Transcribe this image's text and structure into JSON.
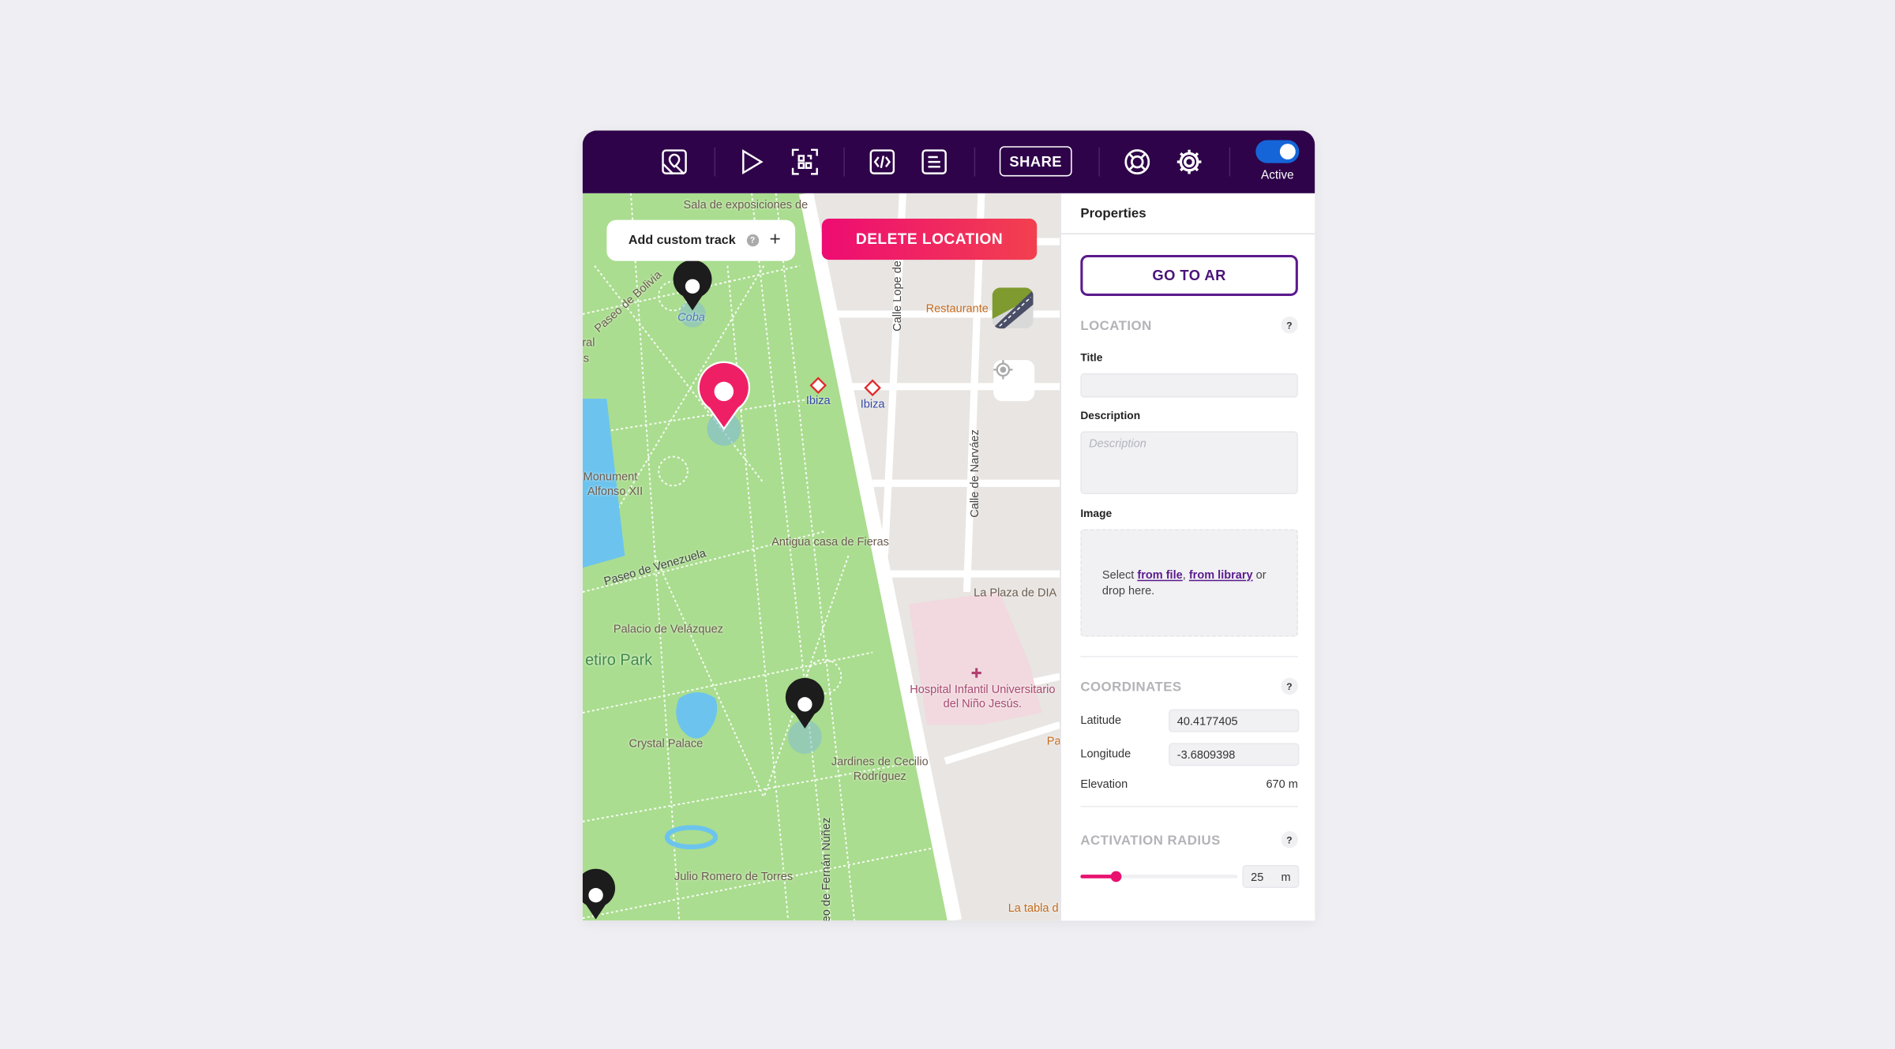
{
  "toolbar": {
    "icons": [
      "map-image-icon",
      "play-icon",
      "qr-scan-icon",
      "code-icon",
      "document-icon",
      "help-lifebuoy-icon",
      "gear-icon"
    ],
    "share_label": "SHARE",
    "toggle_label": "Active",
    "toggle_on": true,
    "background_color": "#2e0349"
  },
  "map": {
    "add_track_label": "Add custom track",
    "add_track_help": "?",
    "add_track_plus": "+",
    "delete_label": "DELETE LOCATION",
    "labels": {
      "sala": "Sala de exposiciones de",
      "bolivia": "Paseo de Bolivia",
      "coba": "Coba",
      "ibiza1": "Ibiza",
      "ibiza2": "Ibiza",
      "restaurante": "Restaurante",
      "lope": "Calle Lope de",
      "narvaez": "Calle de Narváez",
      "monument1": "Monument",
      "monument2": "Alfonso XII",
      "fieras": "Antigua casa de Fieras",
      "venezuela": "Paseo de Venezuela",
      "dia": "La Plaza de DIA",
      "velazquez": "Palacio de Velázquez",
      "retiro": "etiro Park",
      "hospital1": "Hospital Infantil Universitario",
      "hospital2": "del Niño Jesús.",
      "crystal": "Crystal Palace",
      "jardines1": "Jardines de Cecilio",
      "jardines2": "Rodríguez",
      "julio": "Julio Romero de Torres",
      "fernan": "eo de Fernán Núñez",
      "tabla": "La tabla d",
      "pa": "Pa",
      "rral": "ral",
      "rs": "s"
    },
    "colors": {
      "park": "#aadd8f",
      "water": "#6cc4ee",
      "selected_pin": "#ef1f66",
      "pin": "#1c1c1c",
      "hospital": "#f1d9df"
    }
  },
  "panel": {
    "title": "Properties",
    "go_ar_label": "GO TO AR",
    "location": {
      "heading": "LOCATION",
      "help": "?",
      "title_label": "Title",
      "title_value": "",
      "description_label": "Description",
      "description_placeholder": "Description",
      "image_label": "Image",
      "image_select": "Select ",
      "image_from_file": "from file",
      "image_comma": ", ",
      "image_from_library": "from library",
      "image_rest": " or drop here."
    },
    "coordinates": {
      "heading": "COORDINATES",
      "help": "?",
      "latitude_label": "Latitude",
      "latitude_value": "40.4177405",
      "longitude_label": "Longitude",
      "longitude_value": "-3.6809398",
      "elevation_label": "Elevation",
      "elevation_value": "670 m"
    },
    "activation_radius": {
      "heading": "ACTIVATION RADIUS",
      "help": "?",
      "value": "25",
      "unit": "m",
      "slider_fraction": 0.22,
      "accent": "#e8116f"
    }
  }
}
